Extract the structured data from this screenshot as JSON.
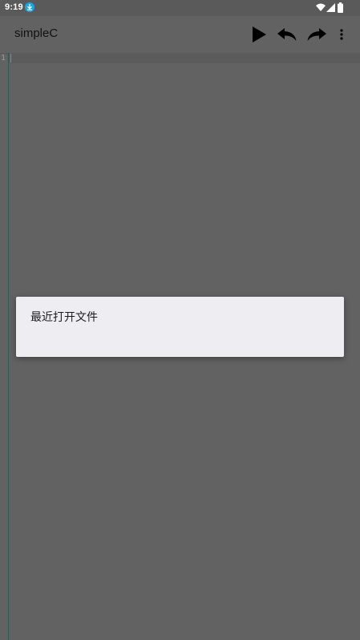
{
  "status_bar": {
    "time": "9:19",
    "icons": [
      "download-icon",
      "wifi-icon",
      "signal-icon",
      "battery-icon"
    ]
  },
  "app_bar": {
    "title": "simpleC",
    "actions": [
      "run-icon",
      "undo-icon",
      "redo-icon",
      "more-vert-icon"
    ]
  },
  "editor": {
    "line_numbers": [
      "1"
    ]
  },
  "dialog": {
    "items": [
      "最近打开文件"
    ]
  },
  "colors": {
    "background": "#636363",
    "dialog_background": "#eeedf2",
    "accent_download": "#18a6e6",
    "gutter": "#2d5a5a"
  }
}
